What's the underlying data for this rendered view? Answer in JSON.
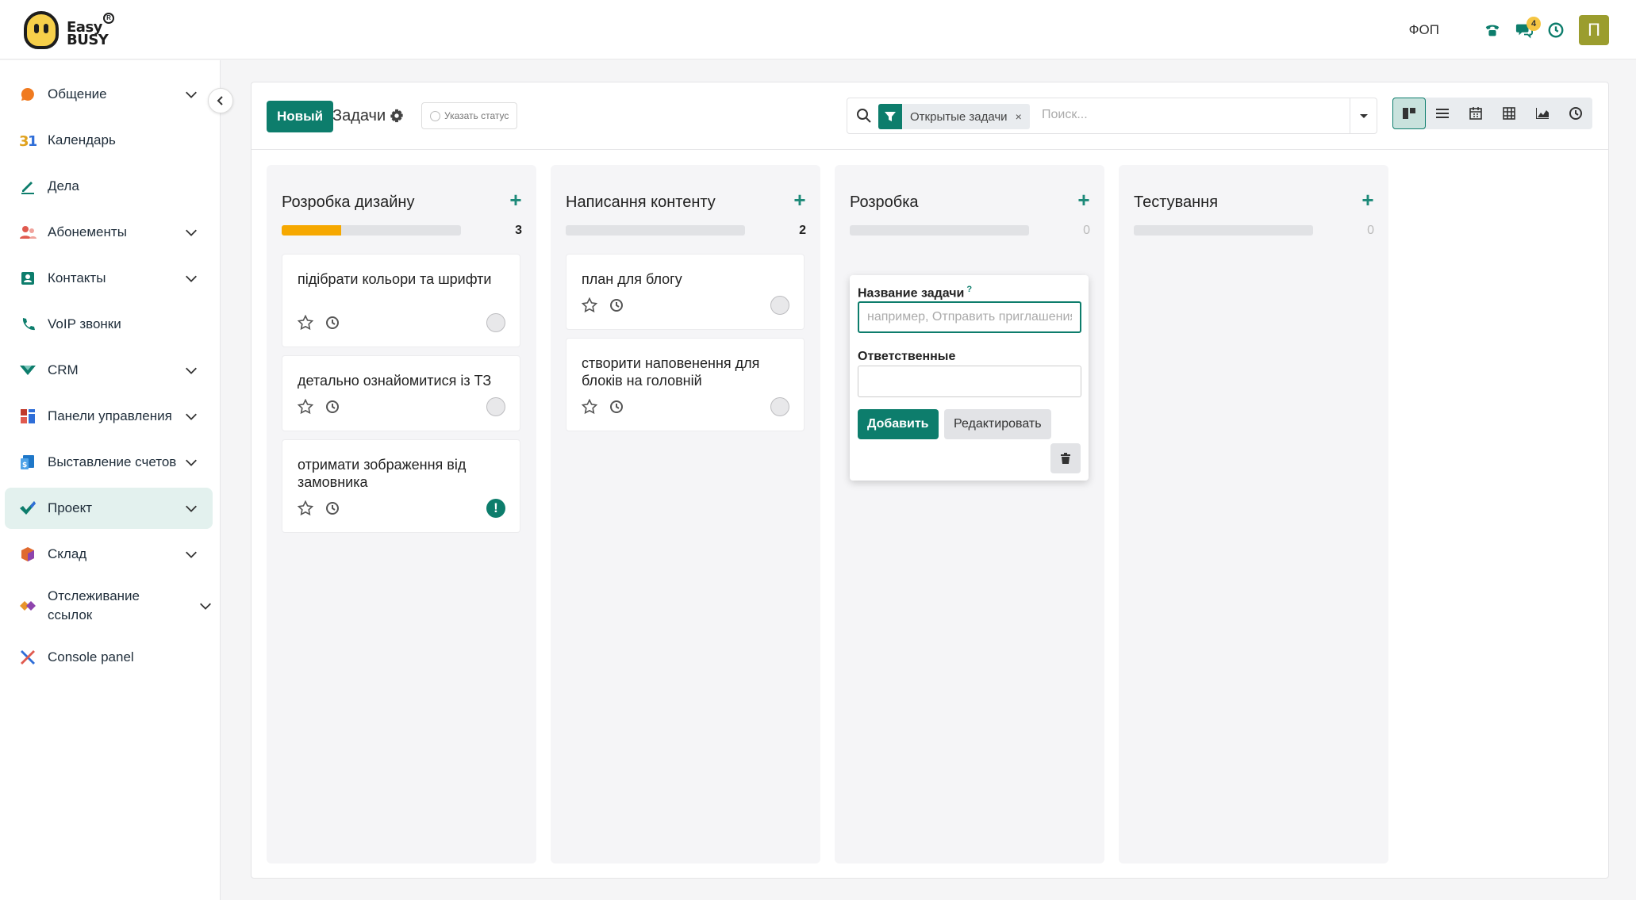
{
  "app": {
    "logo_line1": "Easy",
    "logo_line2": "BUSY",
    "logo_reg": "R"
  },
  "topbar": {
    "company": "ФОП",
    "messages_badge": "4",
    "avatar_letter": "П",
    "icons": [
      "phone-icon",
      "chat-icon",
      "clock-icon"
    ]
  },
  "sidebar": {
    "items": [
      {
        "label": "Общение",
        "icon": "chat-bubble-icon",
        "color": "#f07a1f",
        "expandable": true
      },
      {
        "label": "Календарь",
        "icon": "calendar-31-icon",
        "color": "#e74c3c",
        "expandable": false
      },
      {
        "label": "Дела",
        "icon": "pen-icon",
        "color": "#0d7d6c",
        "expandable": false
      },
      {
        "label": "Абонементы",
        "icon": "users-icon",
        "color": "#e05a4f",
        "expandable": true
      },
      {
        "label": "Контакты",
        "icon": "contact-card-icon",
        "color": "#0d7d6c",
        "expandable": true
      },
      {
        "label": "VoIP звонки",
        "icon": "phone-icon",
        "color": "#0d7d6c",
        "expandable": false
      },
      {
        "label": "CRM",
        "icon": "crm-icon",
        "color": "#0d7d6c",
        "expandable": true
      },
      {
        "label": "Панели управления",
        "icon": "dashboard-icon",
        "color": "#c0392b",
        "expandable": true
      },
      {
        "label": "Выставление счетов",
        "icon": "invoice-icon",
        "color": "#1f77c8",
        "expandable": true
      },
      {
        "label": "Проект",
        "icon": "check-icon",
        "color": "#0d7d6c",
        "expandable": true,
        "active": true
      },
      {
        "label": "Склад",
        "icon": "box-icon",
        "color": "#e06a2f",
        "expandable": true
      },
      {
        "label": "Отслеживание ссылок",
        "icon": "link-tracking-icon",
        "color": "#e8932a",
        "expandable": true
      },
      {
        "label": "Console panel",
        "icon": "tools-icon",
        "color": "#2f6ed8",
        "expandable": false
      }
    ]
  },
  "control_panel": {
    "new_button": "Новый",
    "breadcrumb": "Задачи",
    "status_button": "Указать статус",
    "search": {
      "facet_label": "Открытые задачи",
      "facet_remove": "×",
      "placeholder": "Поиск..."
    },
    "views": [
      "kanban-icon",
      "list-icon",
      "calendar-icon",
      "pivot-icon",
      "graph-icon",
      "activity-icon"
    ],
    "active_view": "kanban-icon"
  },
  "columns": [
    {
      "title": "Розробка дизайну",
      "count": "3",
      "progress": 0.33,
      "cards": [
        {
          "title": "підібрати кольори та шрифти",
          "state": "normal"
        },
        {
          "title": "детально ознайомитися із ТЗ",
          "state": "normal"
        },
        {
          "title": "отримати зображення від замовника",
          "state": "alert",
          "state_glyph": "!"
        }
      ]
    },
    {
      "title": "Написання контенту",
      "count": "2",
      "progress": 0,
      "cards": [
        {
          "title": "план для блогу",
          "state": "normal"
        },
        {
          "title": "створити наповенення для блоків на головній",
          "state": "normal"
        }
      ]
    },
    {
      "title": "Розробка",
      "count": "0",
      "progress": 0,
      "cards": []
    },
    {
      "title": "Тестування",
      "count": "0",
      "progress": 0,
      "cards": []
    }
  ],
  "quick_create": {
    "name_label": "Название задачи",
    "name_help": "?",
    "name_placeholder": "например, Отправить приглашения",
    "assignees_label": "Ответственные",
    "add_button": "Добавить",
    "edit_button": "Редактировать"
  },
  "colors": {
    "primary": "#0d7d6c",
    "progress": "#f6a800",
    "badge": "#f5c542",
    "avatar": "#9b9d2e"
  }
}
